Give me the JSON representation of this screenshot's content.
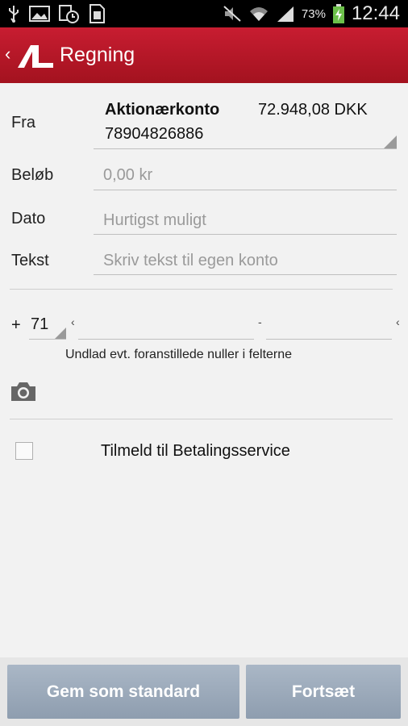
{
  "status_bar": {
    "battery_percent": "73%",
    "time": "12:44",
    "icons": [
      "usb-icon",
      "image-icon",
      "clock-icon",
      "sim-icon",
      "mute-icon",
      "wifi-icon",
      "signal-icon",
      "battery-charging-icon"
    ]
  },
  "action_bar": {
    "title": "Regning",
    "icons": [
      "back-chevron-icon",
      "app-logo-icon"
    ]
  },
  "form": {
    "fra": {
      "label": "Fra",
      "account_name": "Aktionærkonto",
      "account_number": "78904826886",
      "balance": "72.948,08 DKK"
    },
    "belob": {
      "label": "Beløb",
      "placeholder": "0,00 kr"
    },
    "dato": {
      "label": "Dato",
      "placeholder": "Hurtigst muligt"
    },
    "tekst": {
      "label": "Tekst",
      "placeholder": "Skriv tekst til egen konto"
    }
  },
  "fik": {
    "plus": "+",
    "code": "71",
    "separator_left": "‹",
    "separator_mid": "-",
    "separator_right": "‹",
    "hint": "Undlad evt. foranstillede nuller i felterne"
  },
  "camera": {
    "icon": "camera-icon"
  },
  "betalingsservice": {
    "label": "Tilmeld til Betalingsservice",
    "checked": false
  },
  "buttons": {
    "save_default": "Gem som standard",
    "continue": "Fortsæt"
  }
}
